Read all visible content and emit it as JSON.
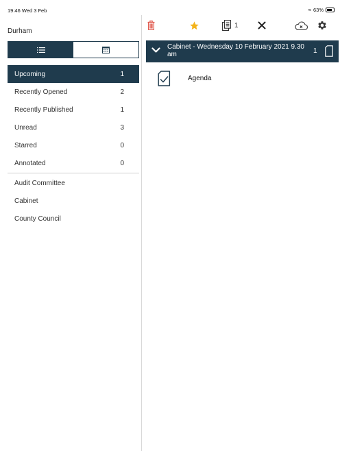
{
  "status_bar": {
    "time": "19:46  Wed 3 Feb",
    "battery": "63%"
  },
  "sidebar": {
    "org_name": "Durham",
    "view_toggle": [
      "list-view",
      "calendar-view"
    ],
    "filters": [
      {
        "label": "Upcoming",
        "count": "1"
      },
      {
        "label": "Recently Opened",
        "count": "2"
      },
      {
        "label": "Recently Published",
        "count": "1"
      },
      {
        "label": "Unread",
        "count": "3"
      },
      {
        "label": "Starred",
        "count": "0"
      },
      {
        "label": "Annotated",
        "count": "0"
      }
    ],
    "committees": [
      {
        "label": "Audit Committee"
      },
      {
        "label": "Cabinet"
      },
      {
        "label": "County Council"
      }
    ]
  },
  "toolbar": {
    "copy_count": "1",
    "icons": [
      "trash-icon",
      "star-icon",
      "copy-documents-icon",
      "close-icon",
      "cloud-sync-icon",
      "gear-icon"
    ]
  },
  "meeting": {
    "title": "Cabinet - Wednesday 10 February 2021 9.30 am",
    "doc_count": "1",
    "documents": [
      {
        "label": "Agenda"
      }
    ]
  },
  "colors": {
    "accent": "#1f3b4d",
    "trash": "#e05a4e",
    "star": "#f3b31b"
  }
}
